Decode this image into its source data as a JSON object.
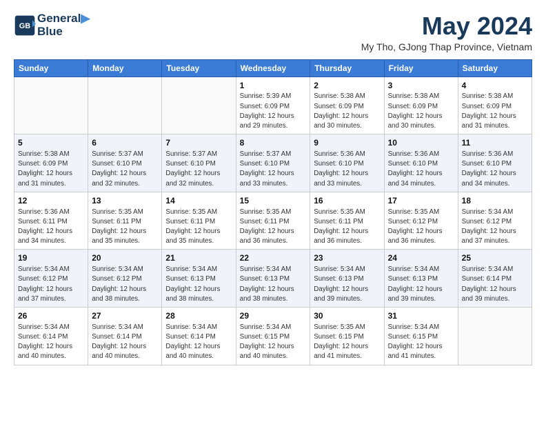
{
  "logo": {
    "line1": "General",
    "line2": "Blue"
  },
  "title": "May 2024",
  "subtitle": "My Tho, GJong Thap Province, Vietnam",
  "headers": [
    "Sunday",
    "Monday",
    "Tuesday",
    "Wednesday",
    "Thursday",
    "Friday",
    "Saturday"
  ],
  "weeks": [
    [
      {
        "day": "",
        "info": ""
      },
      {
        "day": "",
        "info": ""
      },
      {
        "day": "",
        "info": ""
      },
      {
        "day": "1",
        "info": "Sunrise: 5:39 AM\nSunset: 6:09 PM\nDaylight: 12 hours\nand 29 minutes."
      },
      {
        "day": "2",
        "info": "Sunrise: 5:38 AM\nSunset: 6:09 PM\nDaylight: 12 hours\nand 30 minutes."
      },
      {
        "day": "3",
        "info": "Sunrise: 5:38 AM\nSunset: 6:09 PM\nDaylight: 12 hours\nand 30 minutes."
      },
      {
        "day": "4",
        "info": "Sunrise: 5:38 AM\nSunset: 6:09 PM\nDaylight: 12 hours\nand 31 minutes."
      }
    ],
    [
      {
        "day": "5",
        "info": "Sunrise: 5:38 AM\nSunset: 6:09 PM\nDaylight: 12 hours\nand 31 minutes."
      },
      {
        "day": "6",
        "info": "Sunrise: 5:37 AM\nSunset: 6:10 PM\nDaylight: 12 hours\nand 32 minutes."
      },
      {
        "day": "7",
        "info": "Sunrise: 5:37 AM\nSunset: 6:10 PM\nDaylight: 12 hours\nand 32 minutes."
      },
      {
        "day": "8",
        "info": "Sunrise: 5:37 AM\nSunset: 6:10 PM\nDaylight: 12 hours\nand 33 minutes."
      },
      {
        "day": "9",
        "info": "Sunrise: 5:36 AM\nSunset: 6:10 PM\nDaylight: 12 hours\nand 33 minutes."
      },
      {
        "day": "10",
        "info": "Sunrise: 5:36 AM\nSunset: 6:10 PM\nDaylight: 12 hours\nand 34 minutes."
      },
      {
        "day": "11",
        "info": "Sunrise: 5:36 AM\nSunset: 6:10 PM\nDaylight: 12 hours\nand 34 minutes."
      }
    ],
    [
      {
        "day": "12",
        "info": "Sunrise: 5:36 AM\nSunset: 6:11 PM\nDaylight: 12 hours\nand 34 minutes."
      },
      {
        "day": "13",
        "info": "Sunrise: 5:35 AM\nSunset: 6:11 PM\nDaylight: 12 hours\nand 35 minutes."
      },
      {
        "day": "14",
        "info": "Sunrise: 5:35 AM\nSunset: 6:11 PM\nDaylight: 12 hours\nand 35 minutes."
      },
      {
        "day": "15",
        "info": "Sunrise: 5:35 AM\nSunset: 6:11 PM\nDaylight: 12 hours\nand 36 minutes."
      },
      {
        "day": "16",
        "info": "Sunrise: 5:35 AM\nSunset: 6:11 PM\nDaylight: 12 hours\nand 36 minutes."
      },
      {
        "day": "17",
        "info": "Sunrise: 5:35 AM\nSunset: 6:12 PM\nDaylight: 12 hours\nand 36 minutes."
      },
      {
        "day": "18",
        "info": "Sunrise: 5:34 AM\nSunset: 6:12 PM\nDaylight: 12 hours\nand 37 minutes."
      }
    ],
    [
      {
        "day": "19",
        "info": "Sunrise: 5:34 AM\nSunset: 6:12 PM\nDaylight: 12 hours\nand 37 minutes."
      },
      {
        "day": "20",
        "info": "Sunrise: 5:34 AM\nSunset: 6:12 PM\nDaylight: 12 hours\nand 38 minutes."
      },
      {
        "day": "21",
        "info": "Sunrise: 5:34 AM\nSunset: 6:13 PM\nDaylight: 12 hours\nand 38 minutes."
      },
      {
        "day": "22",
        "info": "Sunrise: 5:34 AM\nSunset: 6:13 PM\nDaylight: 12 hours\nand 38 minutes."
      },
      {
        "day": "23",
        "info": "Sunrise: 5:34 AM\nSunset: 6:13 PM\nDaylight: 12 hours\nand 39 minutes."
      },
      {
        "day": "24",
        "info": "Sunrise: 5:34 AM\nSunset: 6:13 PM\nDaylight: 12 hours\nand 39 minutes."
      },
      {
        "day": "25",
        "info": "Sunrise: 5:34 AM\nSunset: 6:14 PM\nDaylight: 12 hours\nand 39 minutes."
      }
    ],
    [
      {
        "day": "26",
        "info": "Sunrise: 5:34 AM\nSunset: 6:14 PM\nDaylight: 12 hours\nand 40 minutes."
      },
      {
        "day": "27",
        "info": "Sunrise: 5:34 AM\nSunset: 6:14 PM\nDaylight: 12 hours\nand 40 minutes."
      },
      {
        "day": "28",
        "info": "Sunrise: 5:34 AM\nSunset: 6:14 PM\nDaylight: 12 hours\nand 40 minutes."
      },
      {
        "day": "29",
        "info": "Sunrise: 5:34 AM\nSunset: 6:15 PM\nDaylight: 12 hours\nand 40 minutes."
      },
      {
        "day": "30",
        "info": "Sunrise: 5:35 AM\nSunset: 6:15 PM\nDaylight: 12 hours\nand 41 minutes."
      },
      {
        "day": "31",
        "info": "Sunrise: 5:34 AM\nSunset: 6:15 PM\nDaylight: 12 hours\nand 41 minutes."
      },
      {
        "day": "",
        "info": ""
      }
    ]
  ]
}
